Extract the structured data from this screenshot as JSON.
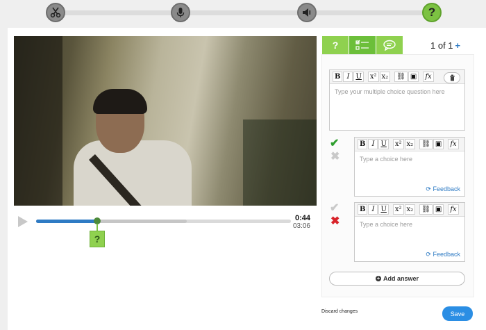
{
  "steps": [
    {
      "icon": "scissors-icon"
    },
    {
      "icon": "microphone-icon"
    },
    {
      "icon": "speaker-icon"
    },
    {
      "icon": "question-icon",
      "label": "?"
    }
  ],
  "player": {
    "current_time": "0:44",
    "total_time": "03:06",
    "played_fraction": 0.24,
    "buffered_fraction": 0.59,
    "question_marker": "?"
  },
  "editor": {
    "tabs": [
      {
        "icon": "question-tab-icon",
        "label": "?"
      },
      {
        "icon": "multiple-choice-tab-icon"
      },
      {
        "icon": "speech-bubble-tab-icon"
      }
    ],
    "counter": "1 of 1",
    "add_symbol": "+",
    "toolbar": {
      "bold": "B",
      "italic": "I",
      "underline": "U",
      "sup": "x²",
      "sub": "x₂",
      "fx": "fx"
    },
    "question_placeholder": "Type your multiple choice question here",
    "choices": [
      {
        "placeholder": "Type a choice here",
        "feedback_label": "Feedback",
        "correct": true
      },
      {
        "placeholder": "Type a choice here",
        "feedback_label": "Feedback",
        "correct": false
      }
    ],
    "add_answer_label": "Add answer",
    "discard_label": "Discard changes",
    "save_label": "Save"
  },
  "colors": {
    "accent_green": "#7cc242",
    "accent_blue": "#2b8ee4",
    "correct": "#2e9e2e",
    "wrong": "#d8232a"
  }
}
